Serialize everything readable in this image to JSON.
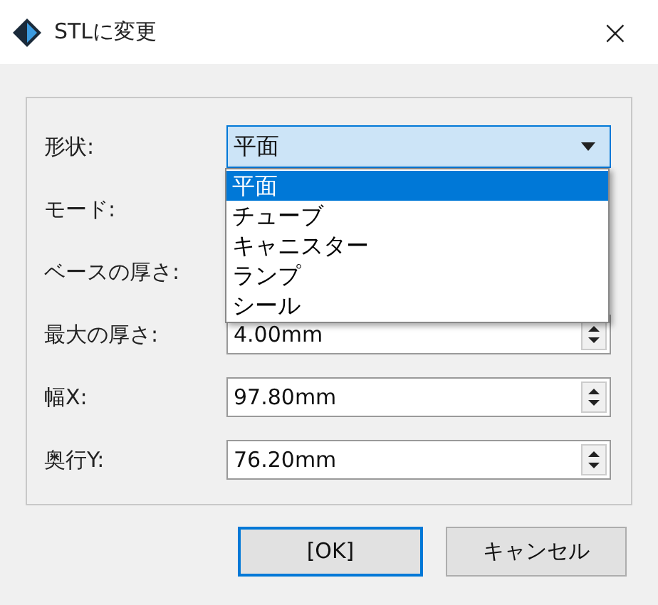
{
  "window": {
    "title": "STLに変更",
    "close": "×"
  },
  "fields": [
    {
      "label": "形状:",
      "kind": "combo",
      "value": "平面"
    },
    {
      "label": "モード:",
      "kind": "hidden"
    },
    {
      "label": "ベースの厚さ:",
      "kind": "hidden"
    },
    {
      "label": "最大の厚さ:",
      "kind": "spin",
      "value": "4.00mm"
    },
    {
      "label": "幅X:",
      "kind": "spin",
      "value": "97.80mm"
    },
    {
      "label": "奥行Y:",
      "kind": "spin",
      "value": "76.20mm"
    }
  ],
  "dropdown": {
    "items": [
      {
        "label": "平面",
        "selected": true
      },
      {
        "label": "チューブ",
        "selected": false
      },
      {
        "label": "キャニスター",
        "selected": false
      },
      {
        "label": "ランプ",
        "selected": false
      },
      {
        "label": "シール",
        "selected": false
      }
    ]
  },
  "buttons": [
    {
      "label": "[OK]",
      "default": true
    },
    {
      "label": "キャンセル",
      "default": false
    }
  ]
}
